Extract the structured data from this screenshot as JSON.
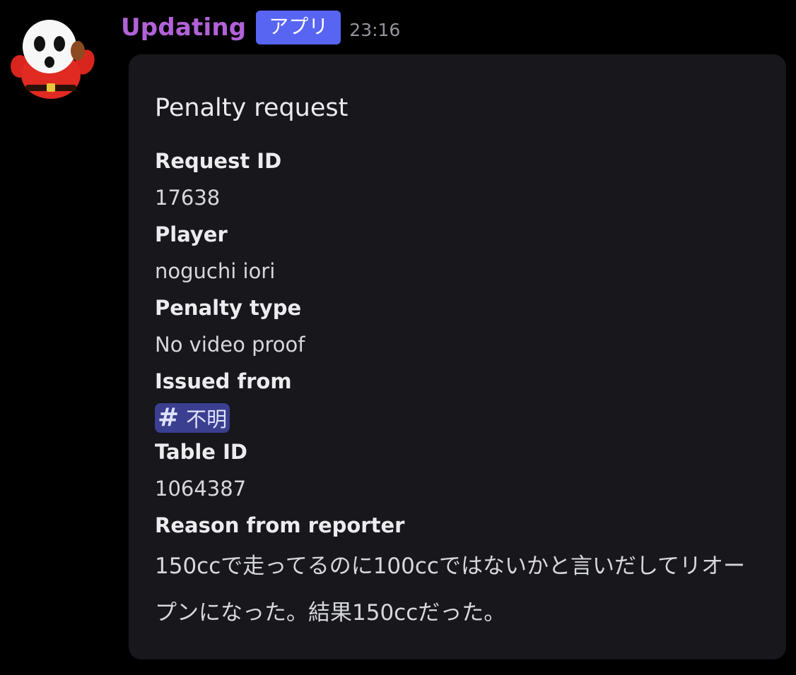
{
  "message": {
    "username": "Updating",
    "app_badge": "アプリ",
    "timestamp": "23:16"
  },
  "embed": {
    "title": "Penalty request",
    "fields": {
      "request_id": {
        "name": "Request ID",
        "value": "17638"
      },
      "player": {
        "name": "Player",
        "value": "noguchi iori"
      },
      "penalty_type": {
        "name": "Penalty type",
        "value": "No video proof"
      },
      "issued_from": {
        "name": "Issued from",
        "channel_hash": "#",
        "channel_name": "不明"
      },
      "table_id": {
        "name": "Table ID",
        "value": "1064387"
      },
      "reason": {
        "name": "Reason from reporter",
        "value": "150ccで走ってるのに100ccではないかと言いだしてリオープンになった。結果150ccだった。"
      }
    }
  },
  "colors": {
    "username": "#b262d8",
    "badge": "#5865f2",
    "embed_bg": "#17171c",
    "mention_bg": "#3a3f8f"
  },
  "icons": {
    "avatar": "shy-guy-avatar-icon"
  }
}
